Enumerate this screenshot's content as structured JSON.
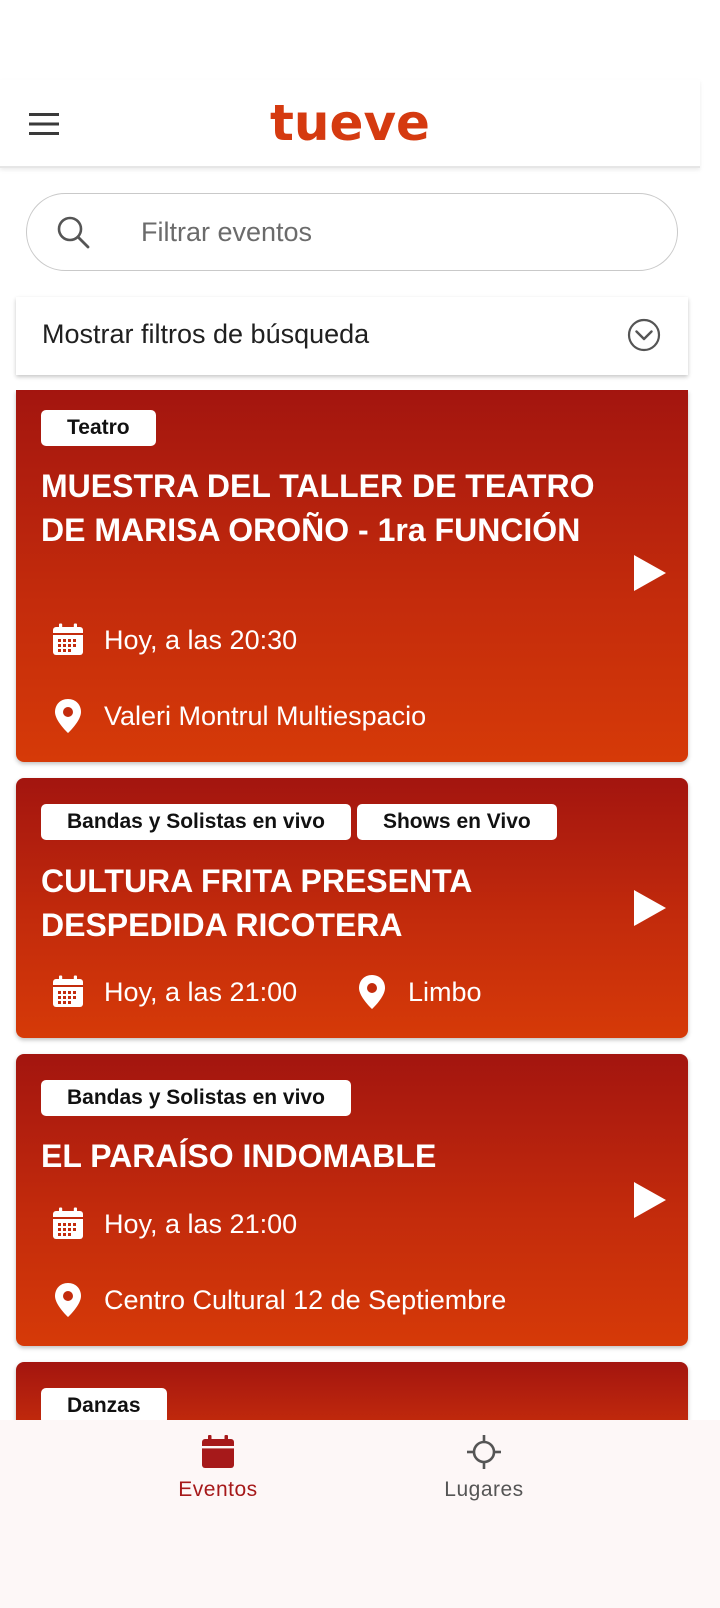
{
  "app": {
    "logo_text": "tueve",
    "brand_color": "#d53a10"
  },
  "header": {
    "menu_icon": "hamburger-menu-icon"
  },
  "search": {
    "placeholder": "Filtrar eventos",
    "value": "",
    "icon": "search-icon"
  },
  "filters": {
    "label": "Mostrar filtros de búsqueda",
    "icon": "chevron-down-circle-icon"
  },
  "events": [
    {
      "tags": [
        "Teatro"
      ],
      "title": "MUESTRA DEL TALLER DE TEATRO DE MARISA OROÑO - 1ra FUNCIÓN",
      "time": "Hoy, a las 20:30",
      "venue": "Valeri Montrul Multiespacio"
    },
    {
      "tags": [
        "Bandas y Solistas en vivo",
        "Shows en Vivo"
      ],
      "title": "CULTURA FRITA PRESENTA DESPEDIDA RICOTERA",
      "time": "Hoy, a las 21:00",
      "venue": "Limbo"
    },
    {
      "tags": [
        "Bandas y Solistas en vivo"
      ],
      "title": "EL PARAÍSO INDOMABLE",
      "time": "Hoy, a las 21:00",
      "venue": "Centro Cultural 12 de Septiembre"
    },
    {
      "tags": [
        "Danzas"
      ]
    }
  ],
  "bottom_nav": {
    "items": [
      {
        "label": "Eventos",
        "icon": "calendar-icon",
        "active": true
      },
      {
        "label": "Lugares",
        "icon": "crosshair-location-icon",
        "active": false
      }
    ],
    "active_color": "#a6191a"
  }
}
